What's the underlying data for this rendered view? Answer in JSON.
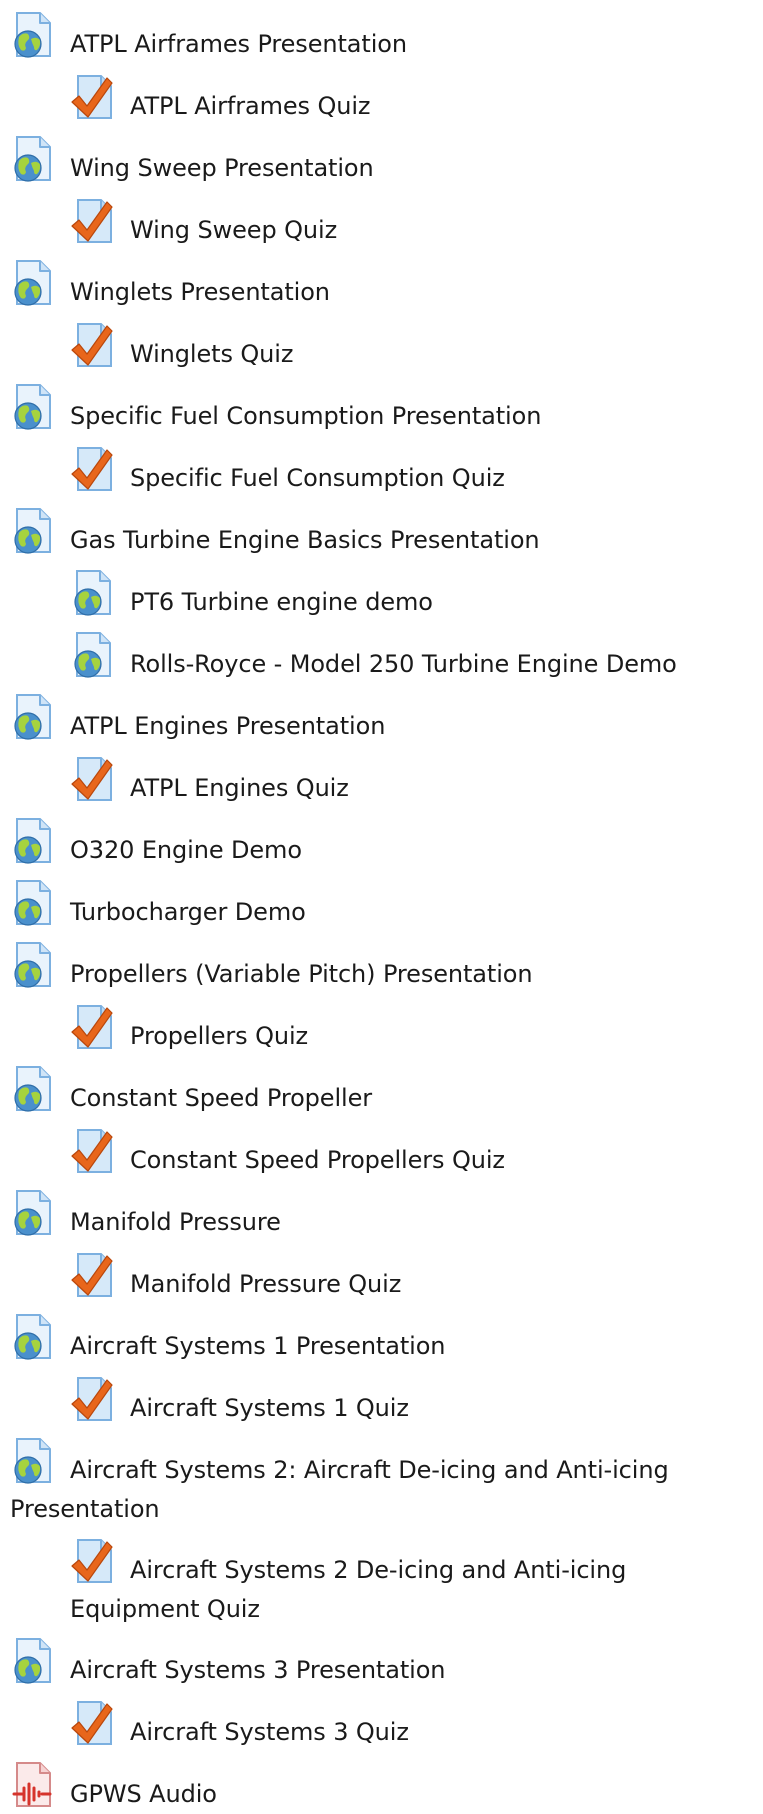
{
  "activities": [
    {
      "label": "ATPL Airframes Presentation",
      "icon": "globe-document-icon",
      "indent": 0
    },
    {
      "label": "ATPL Airframes Quiz",
      "icon": "quiz-checkmark-icon",
      "indent": 1
    },
    {
      "label": "Wing Sweep Presentation",
      "icon": "globe-document-icon",
      "indent": 0
    },
    {
      "label": "Wing Sweep Quiz",
      "icon": "quiz-checkmark-icon",
      "indent": 1
    },
    {
      "label": "Winglets Presentation",
      "icon": "globe-document-icon",
      "indent": 0
    },
    {
      "label": "Winglets Quiz",
      "icon": "quiz-checkmark-icon",
      "indent": 1
    },
    {
      "label": "Specific Fuel Consumption Presentation",
      "icon": "globe-document-icon",
      "indent": 0
    },
    {
      "label": "Specific Fuel Consumption Quiz",
      "icon": "quiz-checkmark-icon",
      "indent": 1
    },
    {
      "label": "Gas Turbine Engine Basics Presentation",
      "icon": "globe-document-icon",
      "indent": 0
    },
    {
      "label": "PT6 Turbine engine demo",
      "icon": "globe-document-icon",
      "indent": 1
    },
    {
      "label": "Rolls-Royce - Model 250 Turbine Engine Demo",
      "icon": "globe-document-icon",
      "indent": 1
    },
    {
      "label": "ATPL Engines Presentation",
      "icon": "globe-document-icon",
      "indent": 0
    },
    {
      "label": "ATPL Engines Quiz",
      "icon": "quiz-checkmark-icon",
      "indent": 1
    },
    {
      "label": "O320 Engine Demo",
      "icon": "globe-document-icon",
      "indent": 0
    },
    {
      "label": "Turbocharger Demo",
      "icon": "globe-document-icon",
      "indent": 0
    },
    {
      "label": "Propellers (Variable Pitch) Presentation",
      "icon": "globe-document-icon",
      "indent": 0
    },
    {
      "label": "Propellers Quiz",
      "icon": "quiz-checkmark-icon",
      "indent": 1
    },
    {
      "label": "Constant Speed Propeller",
      "icon": "globe-document-icon",
      "indent": 0
    },
    {
      "label": "Constant Speed Propellers Quiz",
      "icon": "quiz-checkmark-icon",
      "indent": 1
    },
    {
      "label": "Manifold Pressure",
      "icon": "globe-document-icon",
      "indent": 0
    },
    {
      "label": "Manifold Pressure Quiz",
      "icon": "quiz-checkmark-icon",
      "indent": 1
    },
    {
      "label": "Aircraft Systems 1 Presentation",
      "icon": "globe-document-icon",
      "indent": 0
    },
    {
      "label": "Aircraft Systems 1 Quiz",
      "icon": "quiz-checkmark-icon",
      "indent": 1
    },
    {
      "label": "Aircraft Systems 2: Aircraft De-icing and Anti-icing Presentation",
      "icon": "globe-document-icon",
      "indent": 0
    },
    {
      "label": "Aircraft Systems 2 De-icing and Anti-icing Equipment Quiz",
      "icon": "quiz-checkmark-icon",
      "indent": 1
    },
    {
      "label": "Aircraft Systems 3 Presentation",
      "icon": "globe-document-icon",
      "indent": 0
    },
    {
      "label": "Aircraft Systems 3 Quiz",
      "icon": "quiz-checkmark-icon",
      "indent": 1
    },
    {
      "label": "GPWS Audio",
      "icon": "audio-file-icon",
      "indent": 0
    }
  ]
}
